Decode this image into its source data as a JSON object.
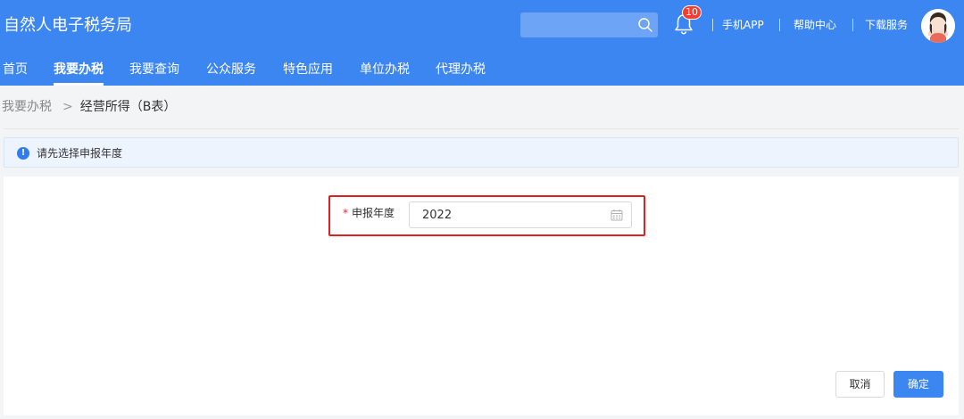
{
  "header": {
    "app_title": "自然人电子税务局",
    "search": {
      "placeholder": ""
    },
    "notification_count": "10",
    "links": [
      "手机APP",
      "帮助中心",
      "下载服务"
    ]
  },
  "nav": {
    "items": [
      "首页",
      "我要办税",
      "我要查询",
      "公众服务",
      "特色应用",
      "单位办税",
      "代理办税"
    ],
    "active": "我要办税"
  },
  "breadcrumb": {
    "home": "我要办税",
    "separator": ">",
    "current": "经营所得（B表）"
  },
  "alert": {
    "icon": "info-icon",
    "text": "请先选择申报年度"
  },
  "form": {
    "required_mark": "*",
    "year_label": "申报年度",
    "year_value": "2022",
    "year_icon": "calendar-icon"
  },
  "actions": {
    "cancel_label": "取消",
    "confirm_label": "确定"
  },
  "colors": {
    "primary": "#3c86f2",
    "highlight_border": "#e02020",
    "required": "#f5222d",
    "badge": "#ff3b30"
  }
}
